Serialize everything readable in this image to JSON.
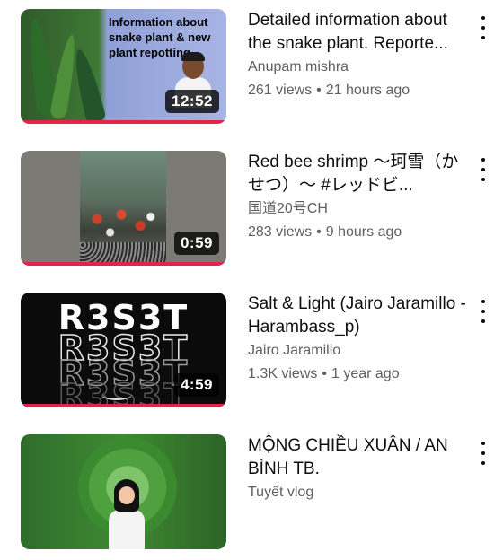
{
  "videos": [
    {
      "thumbnail_caption": "Information about snake plant & new plant repotting",
      "duration": "12:52",
      "title": "Detailed information about the snake plant. Reporte...",
      "channel": "Anupam mishra",
      "views": "261 views",
      "age": "21 hours ago"
    },
    {
      "duration": "0:59",
      "title": "Red bee shrimp ～珂雪（かせつ）～ #レッドビ...",
      "channel": "国道20号CH",
      "views": "283 views",
      "age": "9 hours ago"
    },
    {
      "thumbnail_caption": "R3S3T",
      "duration": "4:59",
      "title": "Salt & Light (Jairo Jaramillo - Harambass_p)",
      "channel": "Jairo Jaramillo",
      "views": "1.3K views",
      "age": "1 year ago"
    },
    {
      "title": "MỘNG CHIỀU XUÂN / AN BÌNH TB.",
      "channel": "Tuyết vlog"
    }
  ],
  "separator": "•",
  "icons": {
    "more": "more-vert-icon"
  },
  "colors": {
    "progress": "#e0244b",
    "meta_text": "#606060",
    "title_text": "#0f0f0f"
  }
}
